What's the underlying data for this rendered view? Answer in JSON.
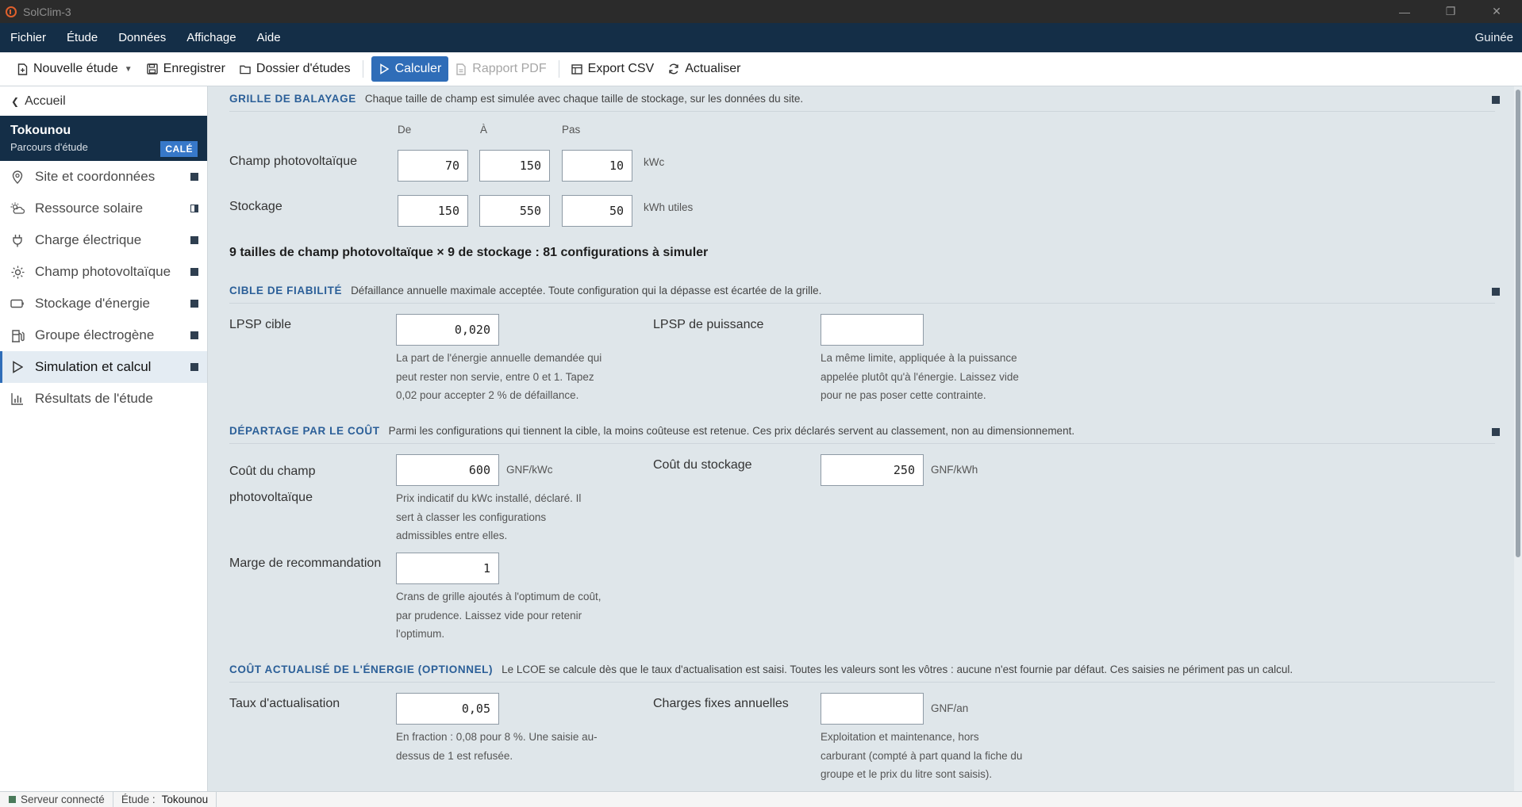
{
  "window": {
    "title": "SolClim-3",
    "controls": {
      "minimize": "—",
      "maximize": "❐",
      "close": "✕"
    }
  },
  "menubar": {
    "items": [
      "Fichier",
      "Étude",
      "Données",
      "Affichage",
      "Aide"
    ],
    "region": "Guinée"
  },
  "toolbar": {
    "new_study": "Nouvelle étude",
    "save": "Enregistrer",
    "studies_folder": "Dossier d'études",
    "compute": "Calculer",
    "pdf_report": "Rapport PDF",
    "export_csv": "Export CSV",
    "refresh": "Actualiser"
  },
  "sidebar": {
    "back": "Accueil",
    "study_name": "Tokounou",
    "study_sub": "Parcours d'étude",
    "study_badge": "CALÉ",
    "items": [
      {
        "label": "Site et coordonnées",
        "icon": "map-pin-icon",
        "state": "complete"
      },
      {
        "label": "Ressource solaire",
        "icon": "sun-cloud-icon",
        "state": "partial"
      },
      {
        "label": "Charge électrique",
        "icon": "plug-icon",
        "state": "complete"
      },
      {
        "label": "Champ photovoltaïque",
        "icon": "sun-icon",
        "state": "complete"
      },
      {
        "label": "Stockage d'énergie",
        "icon": "battery-icon",
        "state": "complete"
      },
      {
        "label": "Groupe électrogène",
        "icon": "fuel-pump-icon",
        "state": "complete"
      },
      {
        "label": "Simulation et calcul",
        "icon": "play-icon",
        "state": "complete",
        "active": true
      },
      {
        "label": "Résultats de l'étude",
        "icon": "bar-chart-icon",
        "state": "none"
      }
    ]
  },
  "sweep": {
    "title": "GRILLE DE BALAYAGE",
    "desc": "Chaque taille de champ est simulée avec chaque taille de stockage, sur les données du site.",
    "col_from": "De",
    "col_to": "À",
    "col_step": "Pas",
    "pv": {
      "label": "Champ photovoltaïque",
      "from": "70",
      "to": "150",
      "step": "10",
      "unit": "kWc"
    },
    "storage": {
      "label": "Stockage",
      "from": "150",
      "to": "550",
      "step": "50",
      "unit": "kWh utiles"
    },
    "summary": "9 tailles de champ photovoltaïque × 9 de stockage : 81 configurations à simuler"
  },
  "reliability": {
    "title": "CIBLE DE FIABILITÉ",
    "desc": "Défaillance annuelle maximale acceptée. Toute configuration qui la dépasse est écartée de la grille.",
    "lpsp_label": "LPSP cible",
    "lpsp_value": "0,020",
    "lpsp_hint": [
      "La part de l'énergie annuelle demandée qui",
      "peut rester non servie, entre 0 et 1. Tapez",
      "0,02 pour accepter 2 % de défaillance."
    ],
    "power_label": "LPSP de puissance",
    "power_value": "",
    "power_hint": [
      "La même limite, appliquée à la puissance",
      "appelée plutôt qu'à l'énergie. Laissez vide",
      "pour ne pas poser cette contrainte."
    ]
  },
  "cost": {
    "title": "DÉPARTAGE PAR LE COÛT",
    "desc": "Parmi les configurations qui tiennent la cible, la moins coûteuse est retenue. Ces prix déclarés servent au classement, non au dimensionnement.",
    "pv_label_1": "Coût du champ",
    "pv_label_2": "photovoltaïque",
    "pv_value": "600",
    "pv_unit": "GNF/kWc",
    "pv_hint": [
      "Prix indicatif du kWc installé, déclaré. Il",
      "sert à classer les configurations",
      "admissibles entre elles."
    ],
    "storage_label": "Coût du stockage",
    "storage_value": "250",
    "storage_unit": "GNF/kWh",
    "margin_label": "Marge de recommandation",
    "margin_value": "1",
    "margin_hint": [
      "Crans de grille ajoutés à l'optimum de coût,",
      "par prudence. Laissez vide pour retenir",
      "l'optimum."
    ]
  },
  "lcoe": {
    "title": "COÛT ACTUALISÉ DE L'ÉNERGIE (OPTIONNEL)",
    "desc": "Le LCOE se calcule dès que le taux d'actualisation est saisi. Toutes les valeurs sont les vôtres : aucune n'est fournie par défaut. Ces saisies ne périment pas un calcul.",
    "rate_label": "Taux d'actualisation",
    "rate_value": "0,05",
    "rate_hint": [
      "En fraction : 0,08 pour 8 %. Une saisie au-",
      "dessus de 1 est refusée."
    ],
    "fixed_label": "Charges fixes annuelles",
    "fixed_value": "",
    "fixed_unit": "GNF/an",
    "fixed_hint": [
      "Exploitation et maintenance, hors",
      "carburant (compté à part quand la fiche du",
      "groupe et le prix du litre sont saisis)."
    ]
  },
  "status": {
    "server": "Serveur connecté",
    "study_label": "Étude :",
    "study_value": "Tokounou"
  }
}
